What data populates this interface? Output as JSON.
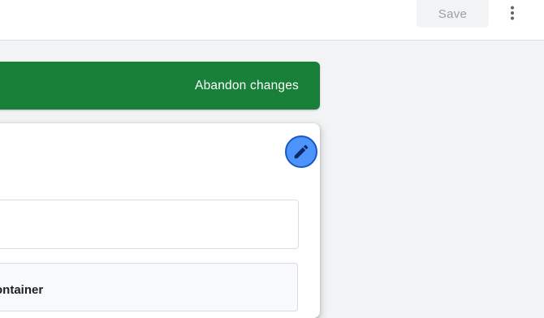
{
  "toolbar": {
    "save_label": "Save",
    "more_icon": "more-vert-icon"
  },
  "banner": {
    "abandon_label": "Abandon changes",
    "color": "#188038"
  },
  "card": {
    "edit_icon": "pencil-icon",
    "container_label": "ontainer"
  },
  "colors": {
    "edit_button_fill": "#4d94ff",
    "edit_button_border": "#1a57c4",
    "page_background": "#f1f3f4"
  }
}
